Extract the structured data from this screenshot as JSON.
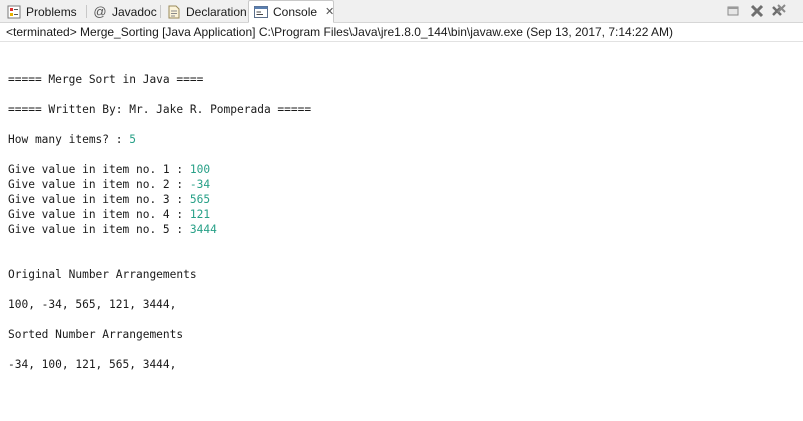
{
  "tabs": [
    {
      "label": "Problems",
      "icon": "problems-icon"
    },
    {
      "label": "Javadoc",
      "icon": "javadoc-at-icon"
    },
    {
      "label": "Declaration",
      "icon": "declaration-icon"
    },
    {
      "label": "Console",
      "icon": "console-icon",
      "active": true
    }
  ],
  "close_glyph": "✕",
  "toolbar": {
    "icons": [
      "minimize-icon",
      "remove-launch-icon",
      "remove-all-terminated-icon"
    ]
  },
  "status_line": "<terminated> Merge_Sorting [Java Application] C:\\Program Files\\Java\\jre1.8.0_144\\bin\\javaw.exe (Sep 13, 2017, 7:14:22 AM)",
  "console": {
    "title_line": "===== Merge Sort in Java ====",
    "author_line": "===== Written By: Mr. Jake R. Pomperada =====",
    "prompt_count": "How many items? : ",
    "input_count": "5",
    "items": [
      {
        "prompt": "Give value in item no. 1 : ",
        "value": "100"
      },
      {
        "prompt": "Give value in item no. 2 : ",
        "value": "-34"
      },
      {
        "prompt": "Give value in item no. 3 : ",
        "value": "565"
      },
      {
        "prompt": "Give value in item no. 4 : ",
        "value": "121"
      },
      {
        "prompt": "Give value in item no. 5 : ",
        "value": "3444"
      }
    ],
    "original_heading": "Original Number Arrangements",
    "original_values": "100, -34, 565, 121, 3444,",
    "sorted_heading": "Sorted Number Arrangements",
    "sorted_values": "-34, 100, 121, 565, 3444,"
  },
  "colors": {
    "input_text": "#27a087",
    "console_text": "#1a1a1a",
    "tabbar_bg": "#f0f0f0"
  }
}
